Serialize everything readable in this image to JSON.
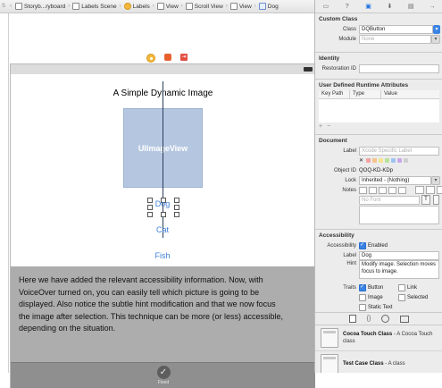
{
  "jumpbar": {
    "crumbs": [
      "Storyb...ryboard",
      "Labels Scene",
      "Labels",
      "View",
      "Scroll View",
      "View",
      "Dog"
    ],
    "overflow_label": "S"
  },
  "scene": {
    "title": "A Simple Dynamic Image",
    "image_label": "UIImageView",
    "buttons": [
      "Dog",
      "Cat",
      "Fish"
    ],
    "info_text": "Here we have added the relevant accessibility information.  Now, with VoiceOver turned on, you can easily tell which picture is going to be displayed.  Also notice the subtle hint modification and that we now focus the image after selection.  This technique can be more (or less) accessible, depending on the situation.",
    "tab_label": "Fixed",
    "tab_icon": "checkmark-icon"
  },
  "inspector": {
    "custom_class": {
      "title": "Custom Class",
      "class_label": "Class",
      "class_value": "DQButton",
      "module_label": "Module",
      "module_value": "None"
    },
    "identity": {
      "title": "Identity",
      "restoration_label": "Restoration ID"
    },
    "runtime_attributes": {
      "title": "User Defined Runtime Attributes",
      "headers": [
        "Key Path",
        "Type",
        "Value"
      ],
      "add": "+",
      "remove": "−"
    },
    "document": {
      "title": "Document",
      "label_label": "Label",
      "label_placeholder": "Xcode Specific Label",
      "object_id_label": "Object ID",
      "object_id_value": "QOQ-KD-KDp",
      "lock_label": "Lock",
      "lock_value": "Inherited - (Nothing)",
      "notes_label": "Notes",
      "font_placeholder": "No Font",
      "swatch_colors": [
        "#f2a3a3",
        "#f6c48b",
        "#f3e58e",
        "#b8e29a",
        "#9fc3f3",
        "#c8a7ea",
        "#cfcfcf"
      ]
    },
    "accessibility": {
      "title": "Accessibility",
      "accessibility_label": "Accessibility",
      "enabled_label": "Enabled",
      "label_label": "Label",
      "label_value": "Dog",
      "hint_label": "Hint",
      "hint_value": "Modify image.  Selection moves focus to image.",
      "traits_label": "Traits",
      "traits": [
        {
          "name": "Button",
          "checked": true
        },
        {
          "name": "Link",
          "checked": false
        },
        {
          "name": "Image",
          "checked": false
        },
        {
          "name": "Selected",
          "checked": false
        },
        {
          "name": "Static Text",
          "checked": false
        }
      ]
    },
    "library": {
      "items": [
        {
          "title": "Cocoa Touch Class",
          "desc": " - A Cocoa Touch class"
        },
        {
          "title": "Test Case Class",
          "desc": " - A class"
        }
      ]
    }
  }
}
